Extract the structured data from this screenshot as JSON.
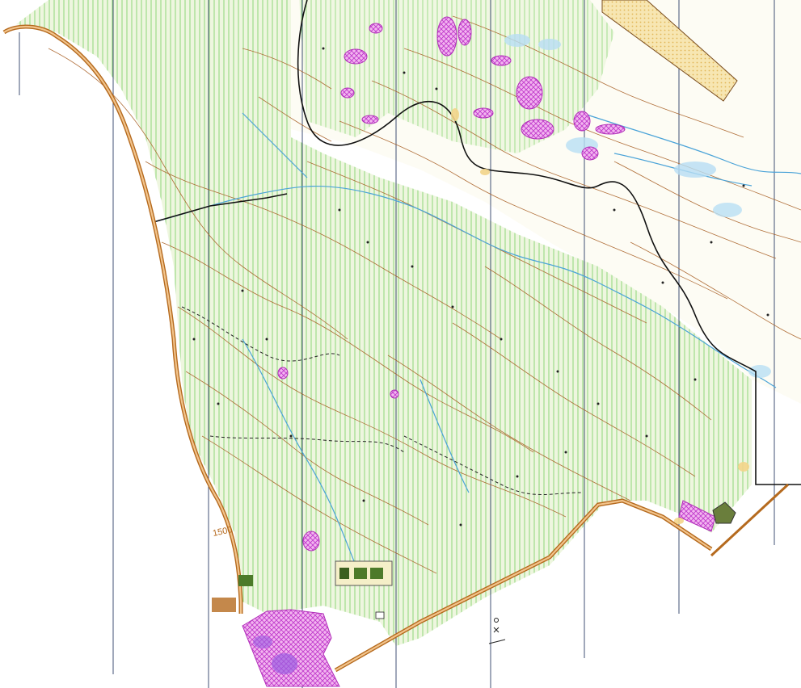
{
  "map": {
    "contour_label": "1500",
    "colors": {
      "background": "#ffffff",
      "open_land": "#fbfaef",
      "forest_green": "#cfeab0",
      "green_stripes": "#7fd26a",
      "contour_brown": "#a4581b",
      "road_brown": "#b56a1e",
      "road_fill": "#e8b37a",
      "water_blue": "#4aa3d8",
      "marsh_blue": "#8cc7ea",
      "magnetic_north_lines": "#2c3e66",
      "boundary_black": "#111111",
      "restricted_purple": "#c03acb",
      "yellow_open": "#f3d58a",
      "building_olive": "#5b6b3a",
      "building_dark": "#333333"
    }
  }
}
